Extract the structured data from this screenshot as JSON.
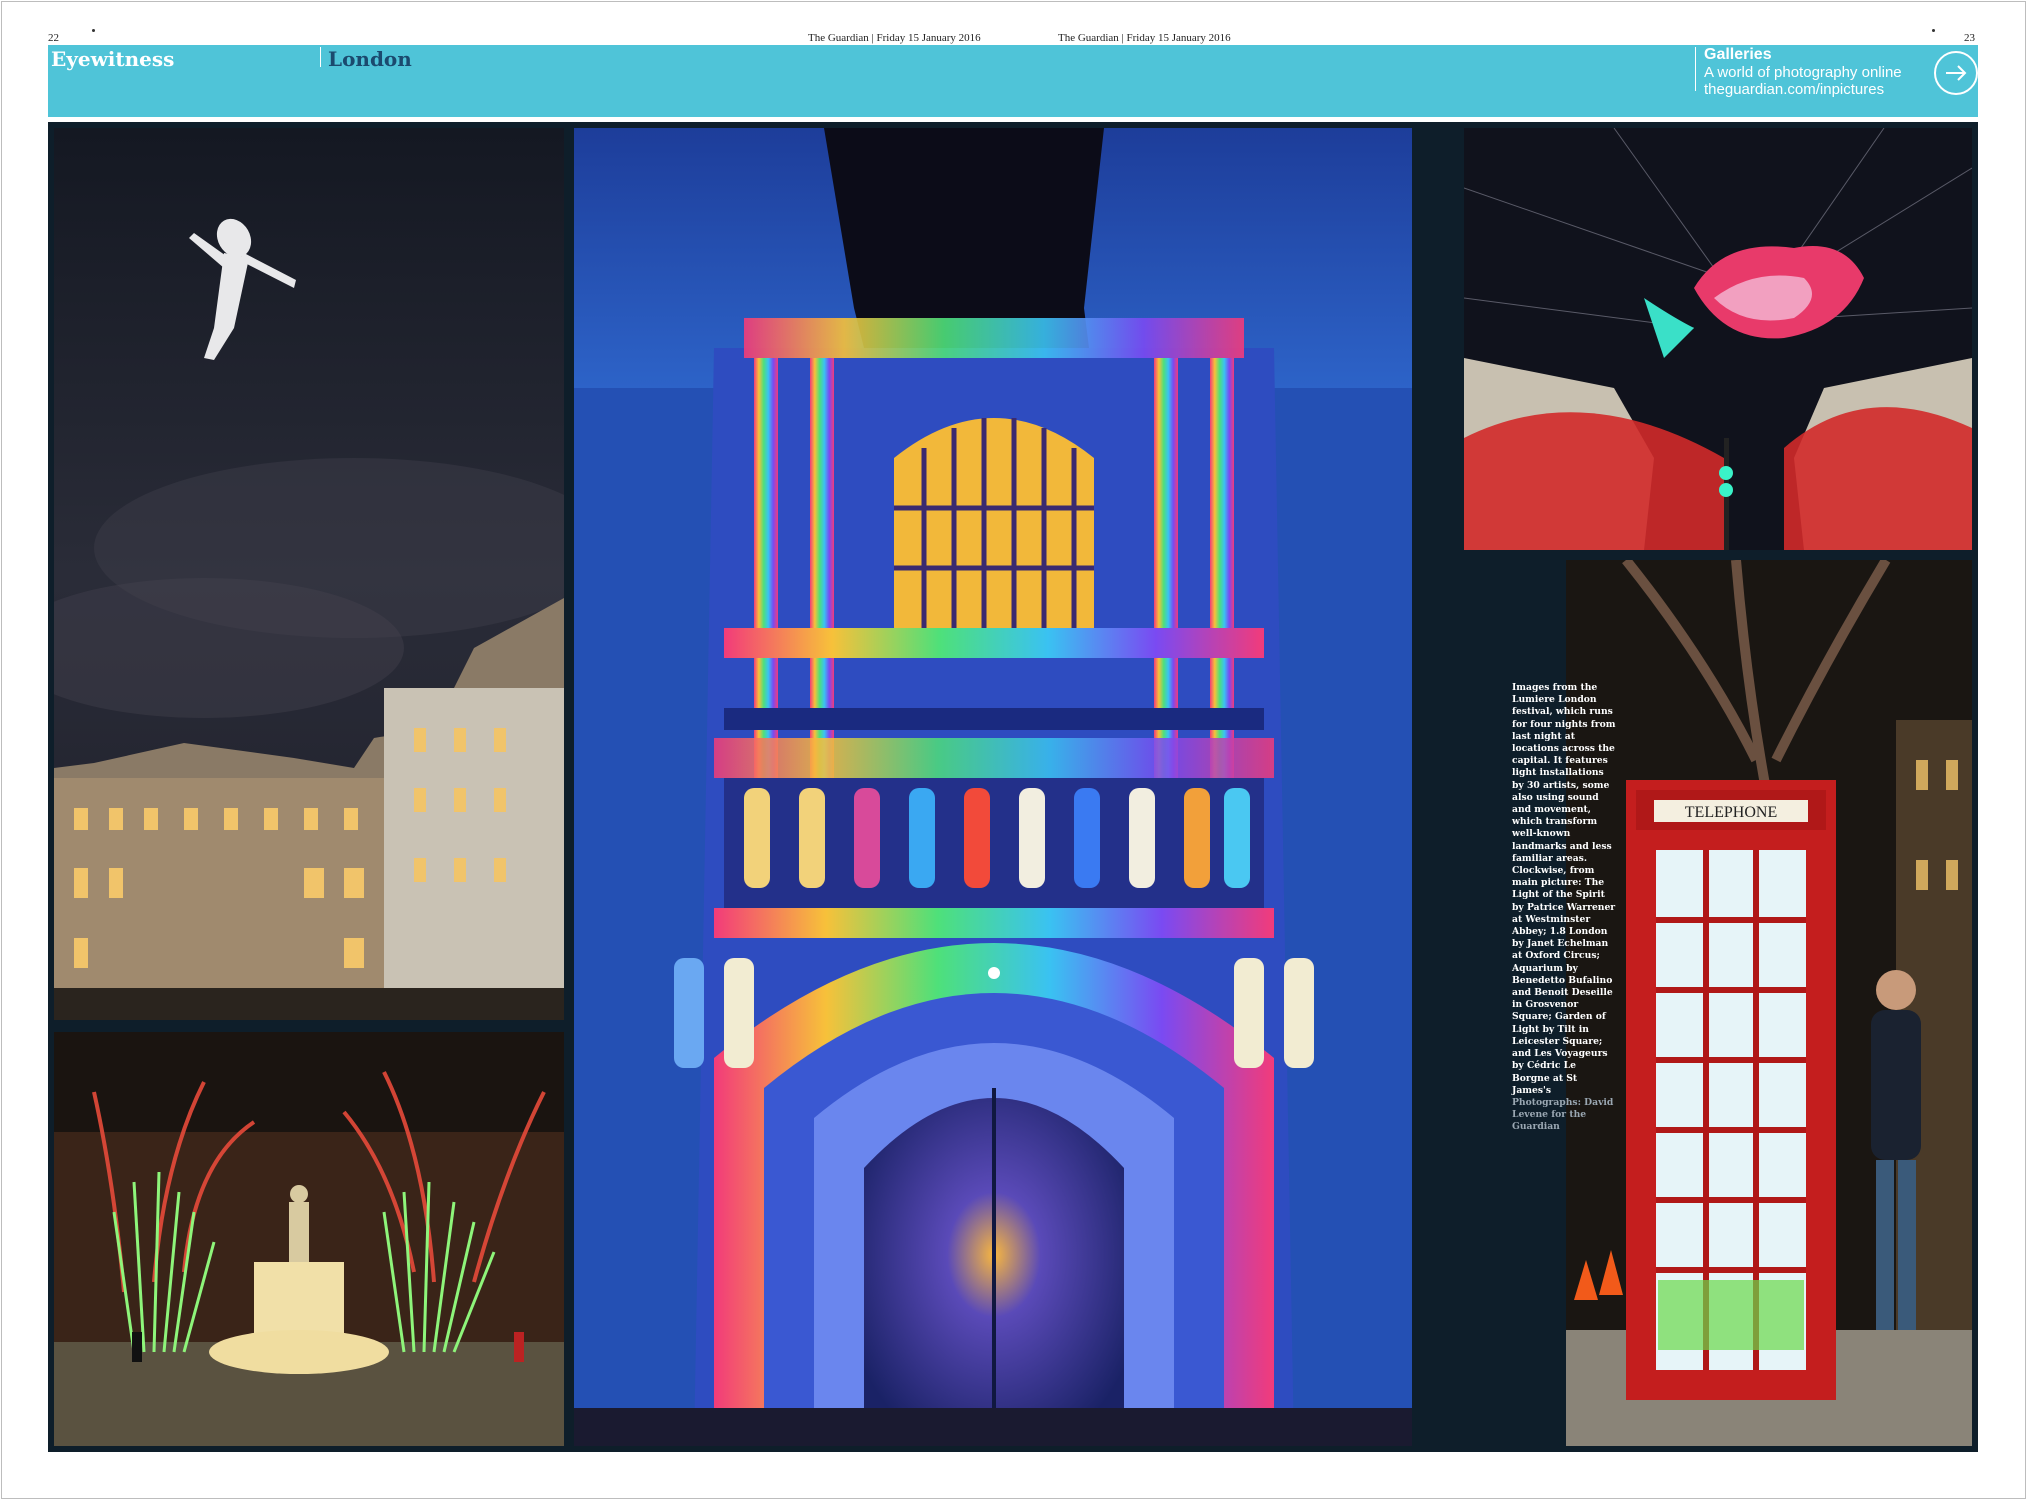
{
  "header": {
    "page_left": "22",
    "page_right": "23",
    "dateline_left": "The Guardian | Friday 15 January 2016",
    "dateline_right": "The Guardian | Friday 15 January 2016"
  },
  "banner": {
    "section": "Eyewitness",
    "subsection": "London",
    "color": "#4fc4d8",
    "galleries_title": "Galleries",
    "galleries_line1": "A world of photography online",
    "galleries_line2": "theguardian.com/inpictures",
    "arrow_icon": "arrow-right-icon"
  },
  "caption": {
    "text": "Images from the Lumiere London festival, which runs for four nights from last night at locations across the capital. It features light installations by 30 artists, some also using sound and movement, which transform well-known landmarks and less familiar areas. Clockwise, from main picture: The Light of the Spirit by Patrice Warrener at Westminster Abbey; 1.8 London by Janet Echelman at Oxford Circus; Aquarium by Benedetto Bufalino and Benoit Deseille in Grosvenor Square; Garden of Light by Tilt in Leicester Square; and Les Voyageurs by Cédric Le Borgne at St James's",
    "credit": "Photographs: David Levene for the Guardian"
  },
  "photos": {
    "phone_box_sign": "TELEPHONE"
  }
}
